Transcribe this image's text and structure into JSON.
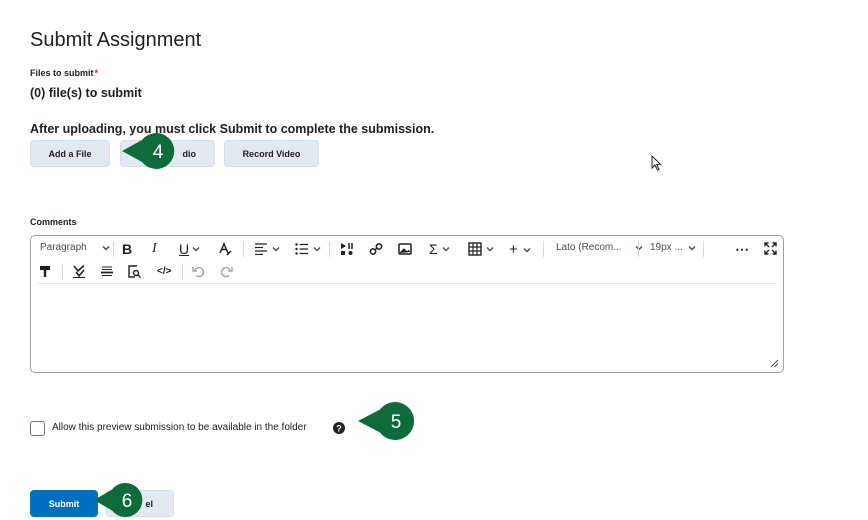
{
  "page": {
    "title": "Submit Assignment"
  },
  "files": {
    "label": "Files to submit",
    "required_marker": "*",
    "count_text": "(0) file(s) to submit",
    "instruction": "After uploading, you must click Submit to complete the submission."
  },
  "upload_buttons": {
    "add_file": "Add a File",
    "record_audio": "dio",
    "record_video": "Record Video"
  },
  "comments": {
    "label": "Comments",
    "toolbar": {
      "paragraph_select": "Paragraph",
      "font_select": "Lato (Recom...",
      "size_select": "19px ...",
      "icons": [
        "bold-icon",
        "italic-icon",
        "underline-icon",
        "text-color-icon",
        "align-icon",
        "list-icon",
        "media-icon",
        "link-icon",
        "image-icon",
        "equation-icon",
        "table-icon",
        "insert-icon",
        "more-icon",
        "fullscreen-icon",
        "format-painter-icon",
        "spellcheck-icon",
        "horizontal-rule-icon",
        "preview-icon",
        "source-code-icon",
        "undo-icon",
        "redo-icon"
      ]
    },
    "value": ""
  },
  "preview": {
    "checkbox_label": "Allow this preview submission to be available in the folder",
    "checked": false
  },
  "actions": {
    "submit": "Submit",
    "cancel": "el"
  },
  "callouts": [
    "4",
    "5",
    "6"
  ],
  "colors": {
    "primary": "#006fbf",
    "button_bg": "#e3e9f1",
    "callout": "#0e6b3a",
    "required": "#cd2026"
  }
}
